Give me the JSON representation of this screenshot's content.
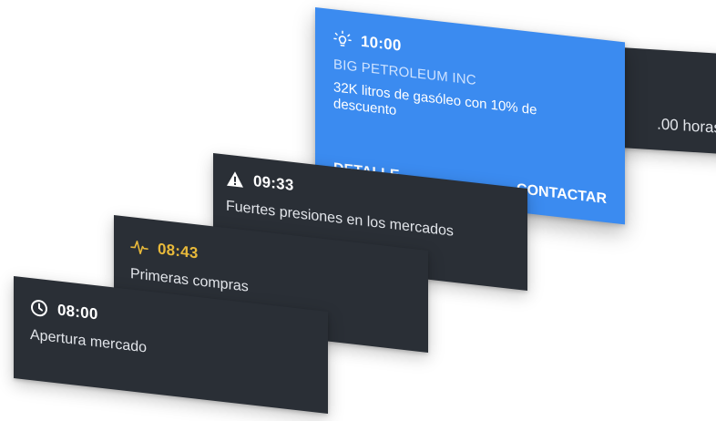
{
  "notifications": [
    {
      "time": "",
      "message": ".00 horas",
      "icon": "none"
    },
    {
      "time": "10:00",
      "company": "BIG PETROLEUM INC",
      "message": "32K litros de gasóleo con 10% de descuento",
      "icon": "lightbulb-icon",
      "actions": {
        "detail_label": "DETALLE",
        "contact_label": "CONTACTAR"
      },
      "color": "#3b8bf0"
    },
    {
      "time": "09:33",
      "message": "Fuertes presiones en los mercados",
      "icon": "warning-icon"
    },
    {
      "time": "08:43",
      "message": "Primeras compras",
      "icon": "pulse-icon",
      "accent": "#e8b93a"
    },
    {
      "time": "08:00",
      "message": "Apertura mercado",
      "icon": "clock-icon"
    }
  ]
}
